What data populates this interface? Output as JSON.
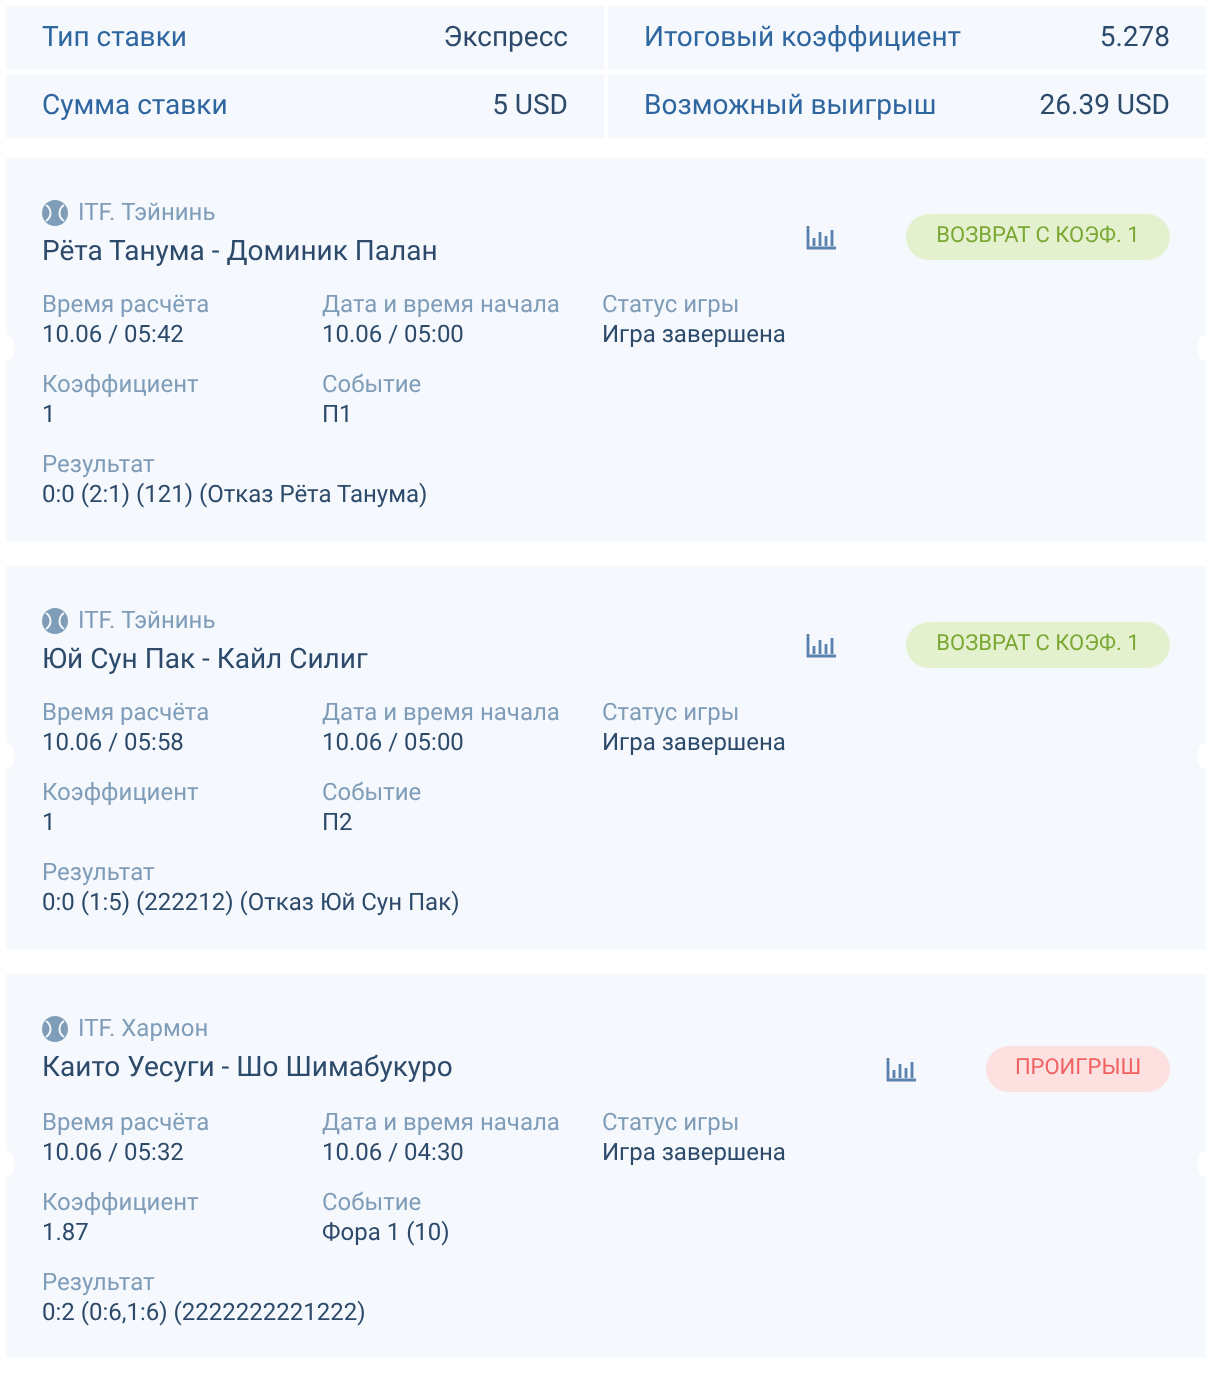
{
  "summary": [
    {
      "label": "Тип ставки",
      "value": "Экспресс"
    },
    {
      "label": "Итоговый коэффициент",
      "value": "5.278"
    },
    {
      "label": "Сумма ставки",
      "value": "5 USD"
    },
    {
      "label": "Возможный выигрыш",
      "value": "26.39 USD"
    }
  ],
  "bets": [
    {
      "tournament": "ITF. Тэйнинь",
      "match": "Рёта Танума - Доминик Палан",
      "status": {
        "kind": "refund",
        "label": "ВОЗВРАТ С КОЭФ. 1"
      },
      "fields": [
        {
          "label": "Время расчёта",
          "value": "10.06 / 05:42"
        },
        {
          "label": "Дата и время начала",
          "value": "10.06 / 05:00"
        },
        {
          "label": "Статус игры",
          "value": "Игра завершена"
        },
        {
          "label": "Коэффициент",
          "value": "1"
        },
        {
          "label": "Событие",
          "value": "П1"
        }
      ],
      "result": {
        "label": "Результат",
        "value": "0:0 (2:1) (121) (Отказ Рёта Танума)"
      }
    },
    {
      "tournament": "ITF. Тэйнинь",
      "match": "Юй Сун Пак - Кайл Силиг",
      "status": {
        "kind": "refund",
        "label": "ВОЗВРАТ С КОЭФ. 1"
      },
      "fields": [
        {
          "label": "Время расчёта",
          "value": "10.06 / 05:58"
        },
        {
          "label": "Дата и время начала",
          "value": "10.06 / 05:00"
        },
        {
          "label": "Статус игры",
          "value": "Игра завершена"
        },
        {
          "label": "Коэффициент",
          "value": "1"
        },
        {
          "label": "Событие",
          "value": "П2"
        }
      ],
      "result": {
        "label": "Результат",
        "value": "0:0 (1:5) (222212) (Отказ Юй Сун Пак)"
      }
    },
    {
      "tournament": "ITF. Хармон",
      "match": "Каито Уесуги - Шо Шимабукуро",
      "status": {
        "kind": "lost",
        "label": "ПРОИГРЫШ"
      },
      "fields": [
        {
          "label": "Время расчёта",
          "value": "10.06 / 05:32"
        },
        {
          "label": "Дата и время начала",
          "value": "10.06 / 04:30"
        },
        {
          "label": "Статус игры",
          "value": "Игра завершена"
        },
        {
          "label": "Коэффициент",
          "value": "1.87"
        },
        {
          "label": "Событие",
          "value": "Фора 1 (10)"
        }
      ],
      "result": {
        "label": "Результат",
        "value": "0:2 (0:6,1:6) (2222222221222)"
      }
    }
  ]
}
